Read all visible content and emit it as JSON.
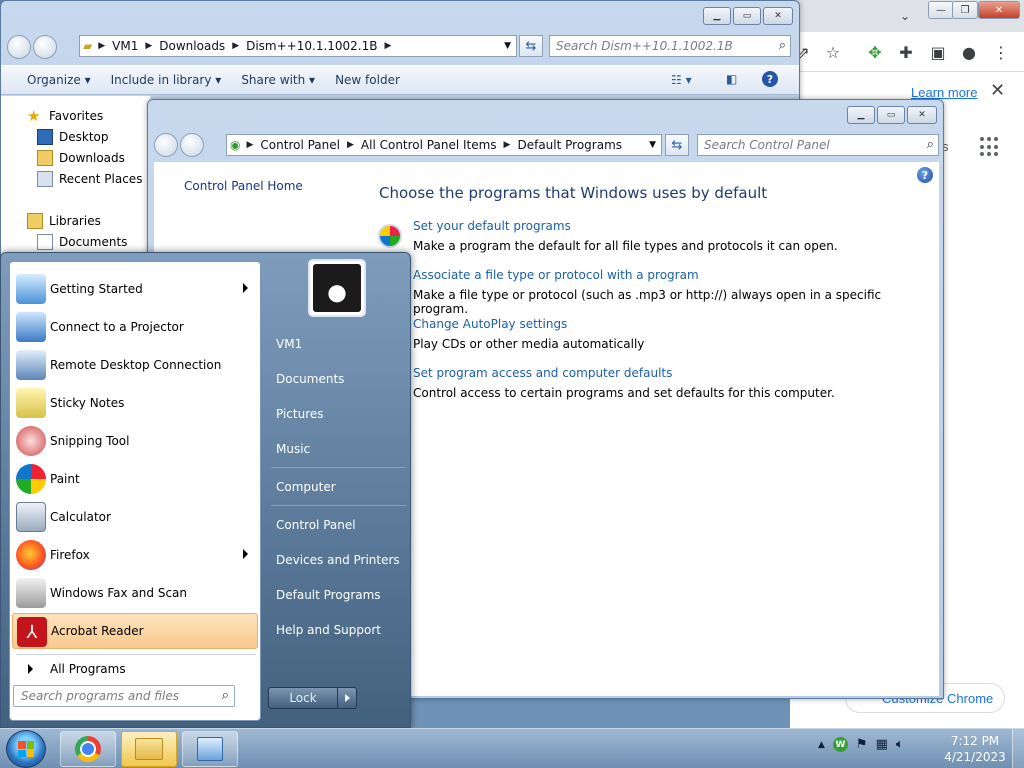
{
  "chrome": {
    "learn_more": "Learn more",
    "customize": "Customize Chrome",
    "partial_text": "s"
  },
  "explorer": {
    "breadcrumb": [
      "VM1",
      "Downloads",
      "Dism++10.1.1002.1B"
    ],
    "search_placeholder": "Search Dism++10.1.1002.1B",
    "commands": [
      "Organize",
      "Include in library",
      "Share with",
      "New folder"
    ],
    "nav": {
      "favorites": "Favorites",
      "desktop": "Desktop",
      "downloads": "Downloads",
      "recent": "Recent Places",
      "libraries": "Libraries",
      "documents": "Documents"
    }
  },
  "cpanel": {
    "breadcrumb": [
      "Control Panel",
      "All Control Panel Items",
      "Default Programs"
    ],
    "search_placeholder": "Search Control Panel",
    "side_link": "Control Panel Home",
    "heading": "Choose the programs that Windows uses by default",
    "tasks": [
      {
        "link": "Set your default programs",
        "desc": "Make a program the default for all file types and protocols it can open."
      },
      {
        "link": "Associate a file type or protocol with a program",
        "desc": "Make a file type or protocol (such as .mp3 or http://) always open in a specific program."
      },
      {
        "link": "Change AutoPlay settings",
        "desc": "Play CDs or other media automatically"
      },
      {
        "link": "Set program access and computer defaults",
        "desc": "Control access to certain programs and set defaults for this computer."
      }
    ]
  },
  "startmenu": {
    "programs": [
      {
        "label": "Getting Started"
      },
      {
        "label": "Connect to a Projector"
      },
      {
        "label": "Remote Desktop Connection"
      },
      {
        "label": "Sticky Notes"
      },
      {
        "label": "Snipping Tool"
      },
      {
        "label": "Paint"
      },
      {
        "label": "Calculator"
      },
      {
        "label": "Firefox"
      },
      {
        "label": "Windows Fax and Scan"
      },
      {
        "label": "Acrobat Reader"
      }
    ],
    "all_programs": "All Programs",
    "search_placeholder": "Search programs and files",
    "right_links": [
      "VM1",
      "Documents",
      "Pictures",
      "Music",
      "Computer",
      "Control Panel",
      "Devices and Printers",
      "Default Programs",
      "Help and Support"
    ],
    "lock": "Lock"
  },
  "taskbar": {
    "time": "7:12 PM",
    "date": "4/21/2023"
  }
}
